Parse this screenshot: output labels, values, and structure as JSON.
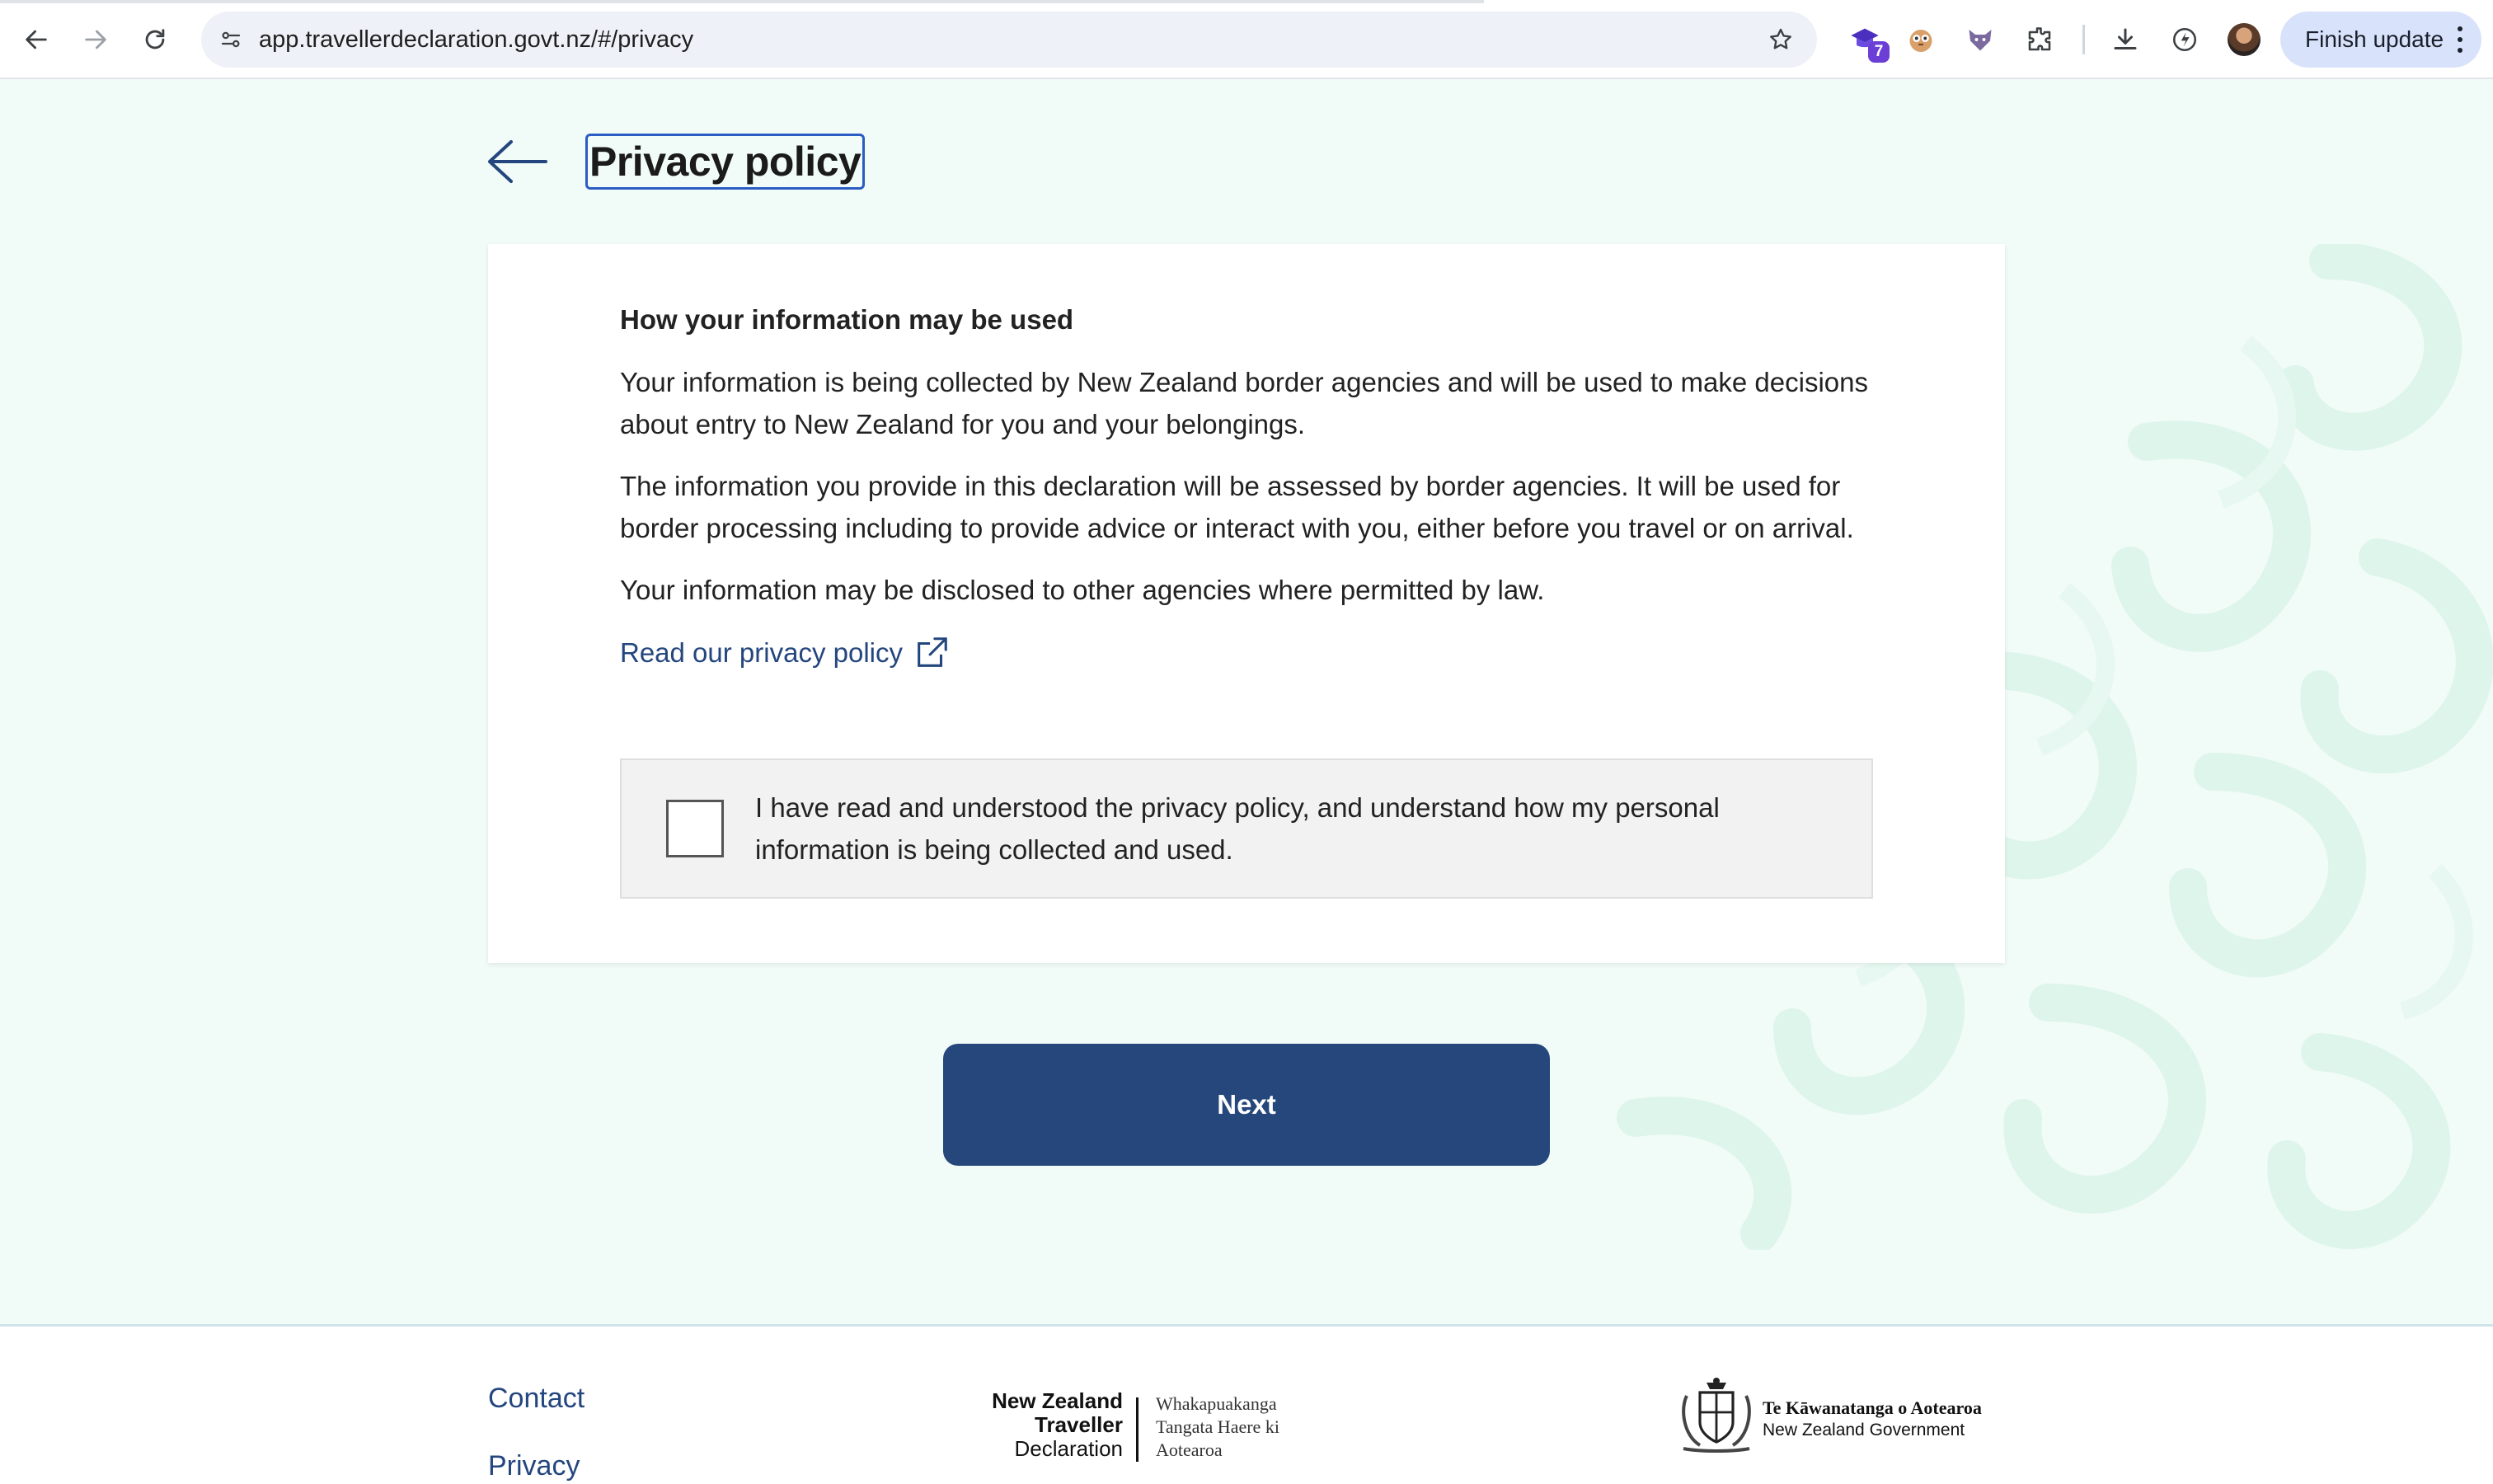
{
  "browser": {
    "url": "app.travellerdeclaration.govt.nz/#/privacy",
    "extension_badge_count": "7",
    "finish_update_label": "Finish update"
  },
  "page": {
    "title": "Privacy policy",
    "section_heading": "How your information may be used",
    "paragraphs": [
      "Your information is being collected by New Zealand border agencies and will be used to make decisions about entry to New Zealand for you and your belongings.",
      "The information you provide in this declaration will be assessed by border agencies. It will be used for border processing including to provide advice or interact with you, either before you travel or on arrival.",
      "Your information may be disclosed to other agencies where permitted by law."
    ],
    "privacy_link_label": "Read our privacy policy",
    "consent_label": "I have read and understood the privacy policy, and understand how my personal information is being collected and used.",
    "consent_checked": false,
    "next_button_label": "Next"
  },
  "footer": {
    "links": [
      "Contact",
      "Privacy"
    ],
    "nztd_logo": {
      "english_lines": [
        "New Zealand",
        "Traveller",
        "Declaration"
      ],
      "maori_lines": [
        "Whakapuakanga",
        "Tangata Haere ki",
        "Aotearoa"
      ]
    },
    "govt_logo": {
      "maori": "Te Kāwanatanga o Aotearoa",
      "english": "New Zealand Government"
    }
  },
  "colors": {
    "page_background": "#f1fbf7",
    "primary_button": "#25477b",
    "link": "#24467e",
    "focus_outline": "#2b5cc3"
  },
  "icons": [
    "back-arrow-icon",
    "forward-arrow-icon",
    "reload-icon",
    "site-info-icon",
    "bookmark-star-icon",
    "extension-puzzle-icon",
    "download-icon",
    "external-link-icon",
    "govt-crest-icon"
  ]
}
